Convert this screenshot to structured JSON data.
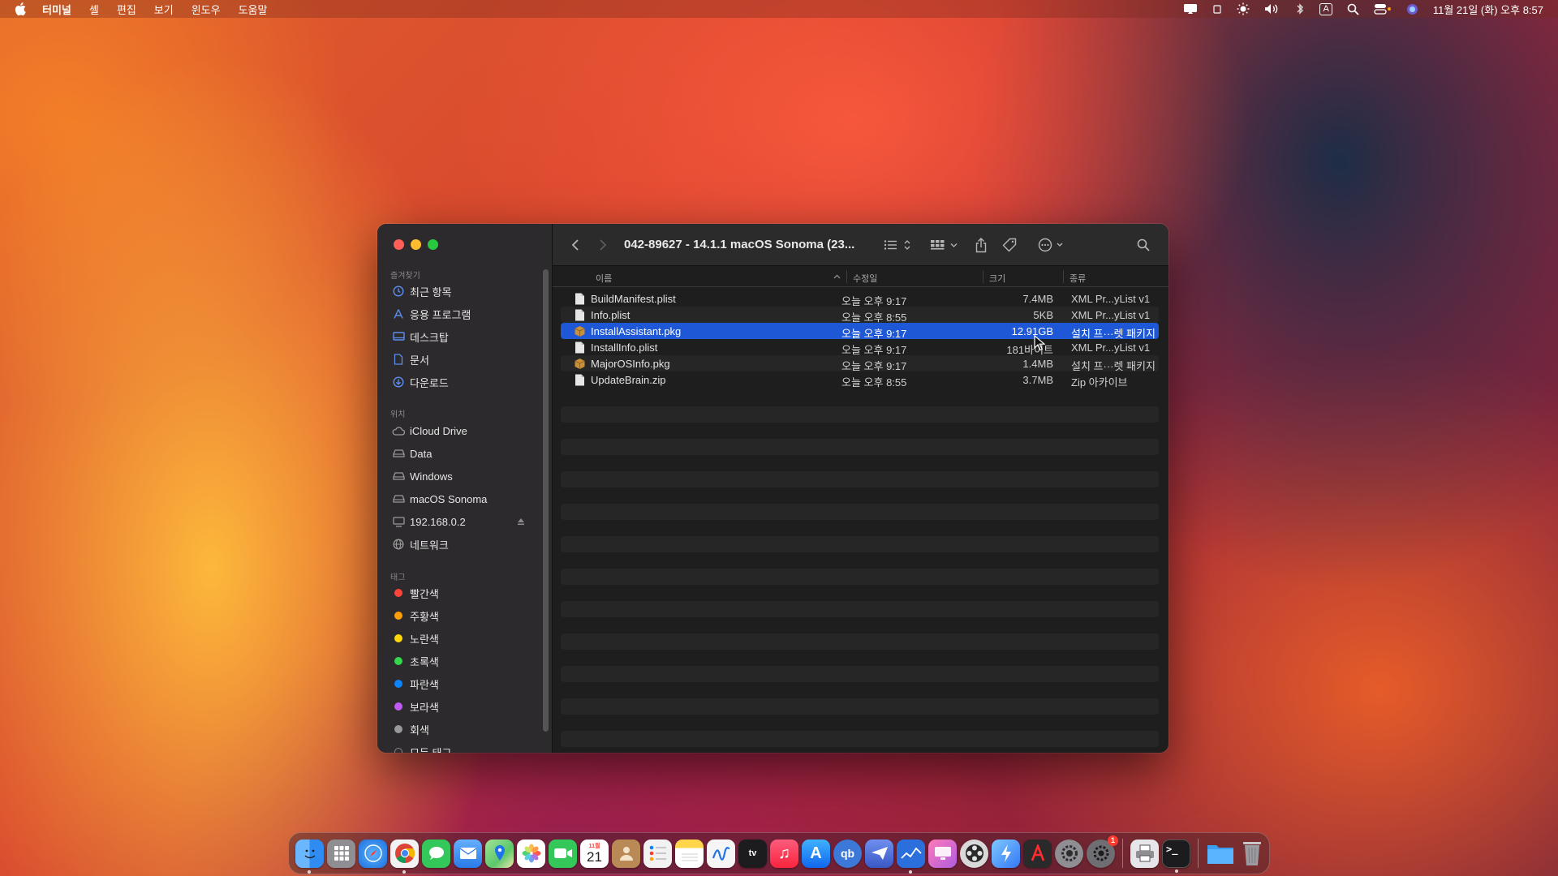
{
  "menubar": {
    "app_name": "터미널",
    "menus": [
      "셸",
      "편집",
      "보기",
      "윈도우",
      "도움말"
    ],
    "input_indicator": "A",
    "clock": "11월 21일 (화) 오후 8:57"
  },
  "window": {
    "title": "042-89627 - 14.1.1 macOS Sonoma (23...",
    "columns": {
      "name": "이름",
      "date": "수정일",
      "size": "크기",
      "kind": "종류"
    }
  },
  "sidebar": {
    "favorites_header": "즐겨찾기",
    "favorites": [
      {
        "label": "최근 항목",
        "icon": "clock-icon"
      },
      {
        "label": "응용 프로그램",
        "icon": "applications-icon"
      },
      {
        "label": "데스크탑",
        "icon": "desktop-icon"
      },
      {
        "label": "문서",
        "icon": "document-icon"
      },
      {
        "label": "다운로드",
        "icon": "download-icon"
      }
    ],
    "locations_header": "위치",
    "locations": [
      {
        "label": "iCloud Drive",
        "icon": "cloud-icon"
      },
      {
        "label": "Data",
        "icon": "disk-icon"
      },
      {
        "label": "Windows",
        "icon": "disk-icon"
      },
      {
        "label": "macOS Sonoma",
        "icon": "disk-icon"
      },
      {
        "label": "192.168.0.2",
        "icon": "computer-icon"
      },
      {
        "label": "네트워크",
        "icon": "network-icon"
      }
    ],
    "tags_header": "태그",
    "tags": [
      {
        "label": "빨간색",
        "color": "#ff453a"
      },
      {
        "label": "주황색",
        "color": "#ff9f0a"
      },
      {
        "label": "노란색",
        "color": "#ffd60a"
      },
      {
        "label": "초록색",
        "color": "#32d74b"
      },
      {
        "label": "파란색",
        "color": "#0a84ff"
      },
      {
        "label": "보라색",
        "color": "#bf5af2"
      },
      {
        "label": "회색",
        "color": "#98989d"
      },
      {
        "label": "모든 태그…",
        "color": ""
      }
    ]
  },
  "files": [
    {
      "name": "BuildManifest.plist",
      "date": "오늘 오후 9:17",
      "size": "7.4MB",
      "kind": "XML Pr...yList v1",
      "type": "doc"
    },
    {
      "name": "Info.plist",
      "date": "오늘 오후 8:55",
      "size": "5KB",
      "kind": "XML Pr...yList v1",
      "type": "doc"
    },
    {
      "name": "InstallAssistant.pkg",
      "date": "오늘 오후 9:17",
      "size": "12.91GB",
      "kind": "설치 프···렛 패키지",
      "type": "pkg",
      "selected": true
    },
    {
      "name": "InstallInfo.plist",
      "date": "오늘 오후 9:17",
      "size": "181바이트",
      "kind": "XML Pr...yList v1",
      "type": "doc"
    },
    {
      "name": "MajorOSInfo.pkg",
      "date": "오늘 오후 9:17",
      "size": "1.4MB",
      "kind": "설치 프···렛 패키지",
      "type": "pkg"
    },
    {
      "name": "UpdateBrain.zip",
      "date": "오늘 오후 8:55",
      "size": "3.7MB",
      "kind": "Zip 아카이브",
      "type": "doc"
    }
  ],
  "dock": {
    "apps": [
      {
        "name": "finder-app",
        "label": "",
        "color": "#2f8cf2",
        "running": true
      },
      {
        "name": "launchpad-app",
        "label": "",
        "color": "#8e8e93"
      },
      {
        "name": "safari-app",
        "label": "",
        "color": "#1e90ff"
      },
      {
        "name": "chrome-app",
        "label": "",
        "color": "#e8e8e8",
        "running": true
      },
      {
        "name": "messages-app",
        "label": "",
        "color": "#34c759"
      },
      {
        "name": "mail-app",
        "label": "",
        "color": "#3a8ef5"
      },
      {
        "name": "maps-app",
        "label": "",
        "color": "#5ac86a"
      },
      {
        "name": "photos-app",
        "label": "",
        "color": "#f5a623"
      },
      {
        "name": "facetime-app",
        "label": "",
        "color": "#34c759"
      },
      {
        "name": "calendar-app",
        "label": "21",
        "color": "#ffffff"
      },
      {
        "name": "contacts-app",
        "label": "",
        "color": "#b98a55"
      },
      {
        "name": "reminders-app",
        "label": "",
        "color": "#f2f2f2"
      },
      {
        "name": "notes-app",
        "label": "",
        "color": "#ffd54a"
      },
      {
        "name": "freeform-app",
        "label": "",
        "color": "#f5f5f5"
      },
      {
        "name": "appletv-app",
        "label": "tv",
        "color": "#1c1c1e"
      },
      {
        "name": "music-app",
        "label": "♫",
        "color": "#fa3c4c"
      },
      {
        "name": "appstore-app",
        "label": "A",
        "color": "#1c8ef9"
      },
      {
        "name": "qbittorrent-app",
        "label": "qb",
        "color": "#3b78d8"
      },
      {
        "name": "mail-send-app",
        "label": "",
        "color": "#4a6cd4"
      },
      {
        "name": "stocks-app",
        "label": "",
        "color": "#2a6fdb",
        "running": true
      },
      {
        "name": "screens-app",
        "label": "",
        "color": "#e06cc9"
      },
      {
        "name": "davinci-app",
        "label": "",
        "color": "#d9d9d9"
      },
      {
        "name": "shortcuts-app",
        "label": "",
        "color": "#59a8f5"
      },
      {
        "name": "acrobat-app",
        "label": "",
        "color": "#2a2a2a"
      },
      {
        "name": "settings-app",
        "label": "",
        "color": "#8e8e93"
      },
      {
        "name": "software-update-app",
        "label": "",
        "color": "#6e6e73",
        "badge": "1"
      },
      {
        "name": "sep"
      },
      {
        "name": "printer-app",
        "label": "",
        "color": "#e5e5ea"
      },
      {
        "name": "terminal-app",
        "label": ">_",
        "color": "#1c1c1e",
        "running": true
      },
      {
        "name": "sep"
      },
      {
        "name": "downloads-folder",
        "label": "",
        "color": "#3b9cf0"
      },
      {
        "name": "trash-app",
        "label": "",
        "color": "#9c9ca0"
      }
    ]
  }
}
